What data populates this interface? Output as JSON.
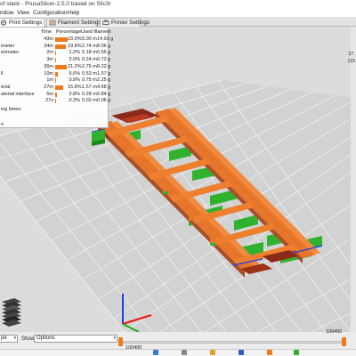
{
  "window": {
    "title": "of stack - PrusaSlicer-2.5.0 based on Slic3r"
  },
  "menu": [
    "ndow",
    "View",
    "Configuration",
    "Help"
  ],
  "tabs": [
    {
      "label": "Print Settings",
      "active": true,
      "icon": "gear-icon"
    },
    {
      "label": "Filament Settings",
      "active": false,
      "icon": "spool-icon"
    },
    {
      "label": "Printer Settings",
      "active": false,
      "icon": "printer-icon"
    }
  ],
  "stats": {
    "headers": {
      "time": "Time",
      "percentage": "Percentage",
      "used": "Used filament"
    },
    "rows": [
      {
        "label": "",
        "time": "43m",
        "percent": 23.9,
        "percent_text": "23.9%",
        "length": "5.00 m",
        "weight": "14.93 g"
      },
      {
        "label": "imeter",
        "time": "34m",
        "percent": 19.8,
        "percent_text": "19.8%",
        "length": "2.74 m",
        "weight": "8.06 g"
      },
      {
        "label": "erimeter",
        "time": "2m",
        "percent": 1.2,
        "percent_text": "1.2%",
        "length": "0.18 m",
        "weight": "0.55 g"
      },
      {
        "label": "",
        "time": "3m",
        "percent": 2.0,
        "percent_text": "2.0%",
        "length": "0.24 m",
        "weight": "0.72 g"
      },
      {
        "label": "",
        "time": "36m",
        "percent": 21.2,
        "percent_text": "21.2%",
        "length": "2.76 m",
        "weight": "8.22 g"
      },
      {
        "label": "ll",
        "time": "10m",
        "percent": 5.6,
        "percent_text": "5.6%",
        "length": "0.53 m",
        "weight": "1.57 g"
      },
      {
        "label": "",
        "time": "1m",
        "percent": 0.9,
        "percent_text": "0.9%",
        "length": "0.75 m",
        "weight": "2.25 g"
      },
      {
        "label": "erial",
        "time": "27m",
        "percent": 15.8,
        "percent_text": "15.8%",
        "length": "1.57 m",
        "weight": "4.68 g"
      },
      {
        "label": "aterial interface",
        "time": "5m",
        "percent": 2.8,
        "percent_text": "2.8%",
        "length": "0.28 m",
        "weight": "0.84 g"
      },
      {
        "label": "",
        "time": "27s",
        "percent": 0.3,
        "percent_text": "0.3%",
        "length": "0.02 m",
        "weight": "0.06 g"
      }
    ],
    "footer1": "ing times:",
    "footer2": "n"
  },
  "right_ruler": {
    "top": "27.",
    "mid": "(15"
  },
  "bottom": {
    "type_combo": "pe",
    "show_label": "Show",
    "options_combo": "Options",
    "slider_min": "100400",
    "slider_max": "100450"
  },
  "colors": {
    "perimeter": "#ef7a1a",
    "support": "#2fb32f",
    "bed": "#d6d6d6",
    "bar": "#ef7a1a"
  }
}
